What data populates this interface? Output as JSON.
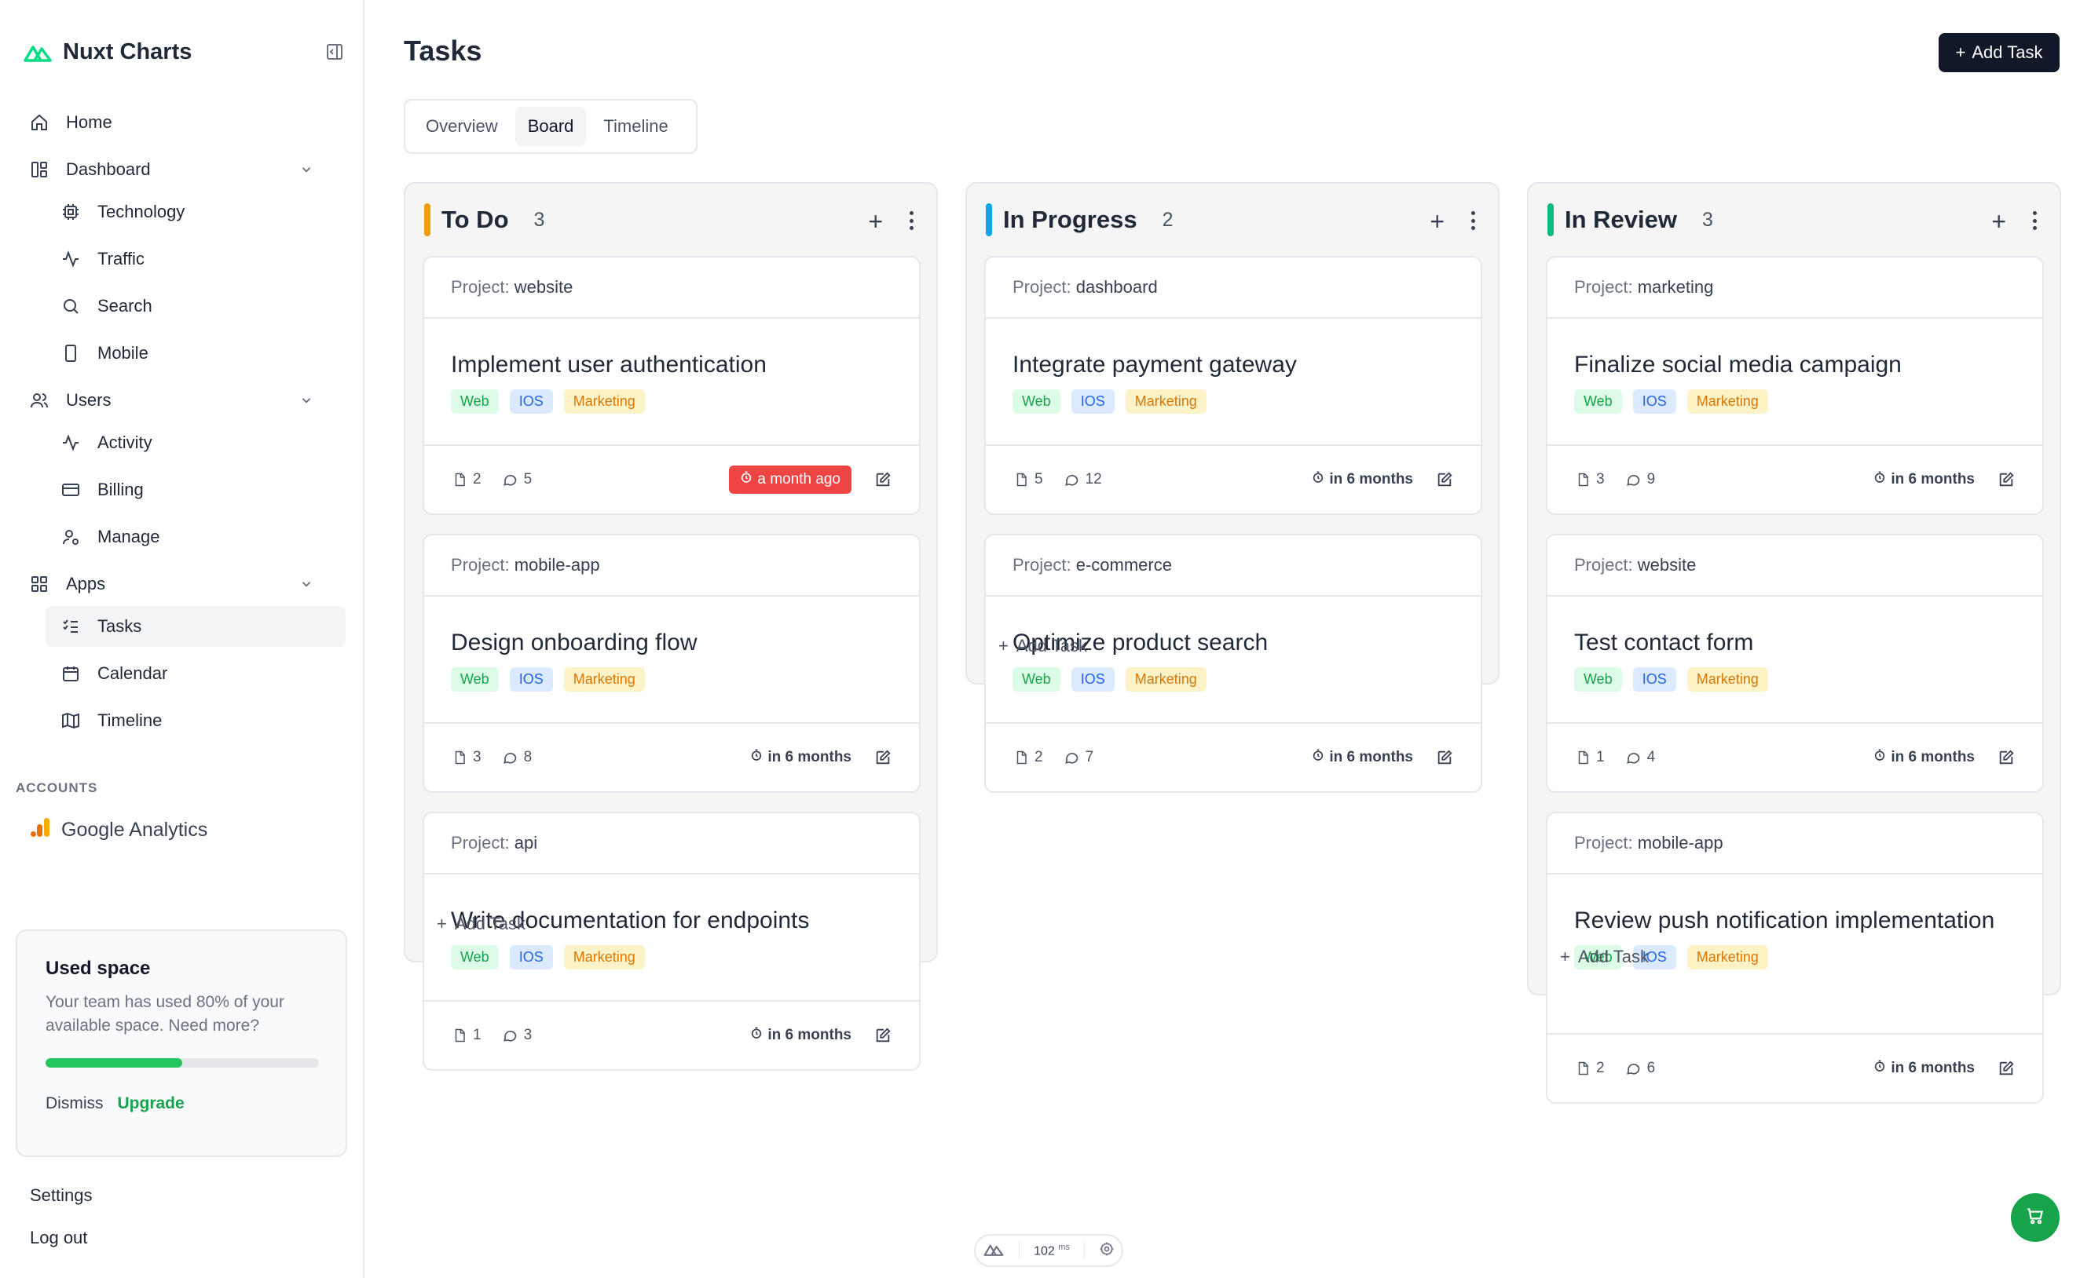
{
  "app": {
    "name": "Nuxt Charts",
    "brand_color": "#00DC82"
  },
  "sidebar": {
    "items": [
      {
        "label": "Home",
        "icon": "home-icon"
      },
      {
        "label": "Dashboard",
        "icon": "dashboard-icon",
        "expanded": true,
        "children": [
          {
            "label": "Technology",
            "icon": "cpu-icon"
          },
          {
            "label": "Traffic",
            "icon": "activity-icon"
          },
          {
            "label": "Search",
            "icon": "search-icon"
          },
          {
            "label": "Mobile",
            "icon": "smartphone-icon"
          }
        ]
      },
      {
        "label": "Users",
        "icon": "users-icon",
        "expanded": true,
        "children": [
          {
            "label": "Activity",
            "icon": "activity-icon"
          },
          {
            "label": "Billing",
            "icon": "credit-card-icon"
          },
          {
            "label": "Manage",
            "icon": "user-cog-icon"
          }
        ]
      },
      {
        "label": "Apps",
        "icon": "apps-icon",
        "expanded": true,
        "children": [
          {
            "label": "Tasks",
            "icon": "list-checks-icon",
            "active": true
          },
          {
            "label": "Calendar",
            "icon": "calendar-icon"
          },
          {
            "label": "Timeline",
            "icon": "map-icon"
          }
        ]
      }
    ],
    "accounts_label": "ACCOUNTS",
    "account": {
      "label": "Google Analytics",
      "icon": "google-analytics-icon"
    },
    "space_card": {
      "title": "Used space",
      "description": "Your team has used 80% of your available space. Need more?",
      "progress_fraction": 0.5,
      "dismiss": "Dismiss",
      "upgrade": "Upgrade"
    },
    "settings": "Settings",
    "logout": "Log out"
  },
  "header": {
    "title": "Tasks",
    "add_task": "Add Task"
  },
  "tabs": [
    {
      "label": "Overview",
      "active": false
    },
    {
      "label": "Board",
      "active": true
    },
    {
      "label": "Timeline",
      "active": false
    }
  ],
  "board": {
    "project_prefix": "Project:",
    "tags": [
      "Web",
      "IOS",
      "Marketing"
    ],
    "add_task": "Add Task",
    "columns": [
      {
        "title": "To Do",
        "count": "3",
        "color": "#f59e0b",
        "cards": [
          {
            "project": "website",
            "title": "Implement user authentication",
            "files": "2",
            "comments": "5",
            "due": "a month ago",
            "overdue": true
          },
          {
            "project": "mobile-app",
            "title": "Design onboarding flow",
            "files": "3",
            "comments": "8",
            "due": "in 6 months",
            "overdue": false
          },
          {
            "project": "api",
            "title": "Write documentation for endpoints",
            "files": "1",
            "comments": "3",
            "due": "in 6 months",
            "overdue": false
          }
        ]
      },
      {
        "title": "In Progress",
        "count": "2",
        "color": "#0ea5e9",
        "cards": [
          {
            "project": "dashboard",
            "title": "Integrate payment gateway",
            "files": "5",
            "comments": "12",
            "due": "in 6 months",
            "overdue": false
          },
          {
            "project": "e-commerce",
            "title": "Optimize product search",
            "files": "2",
            "comments": "7",
            "due": "in 6 months",
            "overdue": false
          }
        ]
      },
      {
        "title": "In Review",
        "count": "3",
        "color": "#10b981",
        "cards": [
          {
            "project": "marketing",
            "title": "Finalize social media campaign",
            "files": "3",
            "comments": "9",
            "due": "in 6 months",
            "overdue": false
          },
          {
            "project": "website",
            "title": "Test contact form",
            "files": "1",
            "comments": "4",
            "due": "in 6 months",
            "overdue": false
          },
          {
            "project": "mobile-app",
            "title": "Review push notification implementation",
            "files": "2",
            "comments": "6",
            "due": "in 6 months",
            "overdue": false
          }
        ]
      }
    ]
  },
  "devtools": {
    "value": "102",
    "unit": "ms"
  }
}
